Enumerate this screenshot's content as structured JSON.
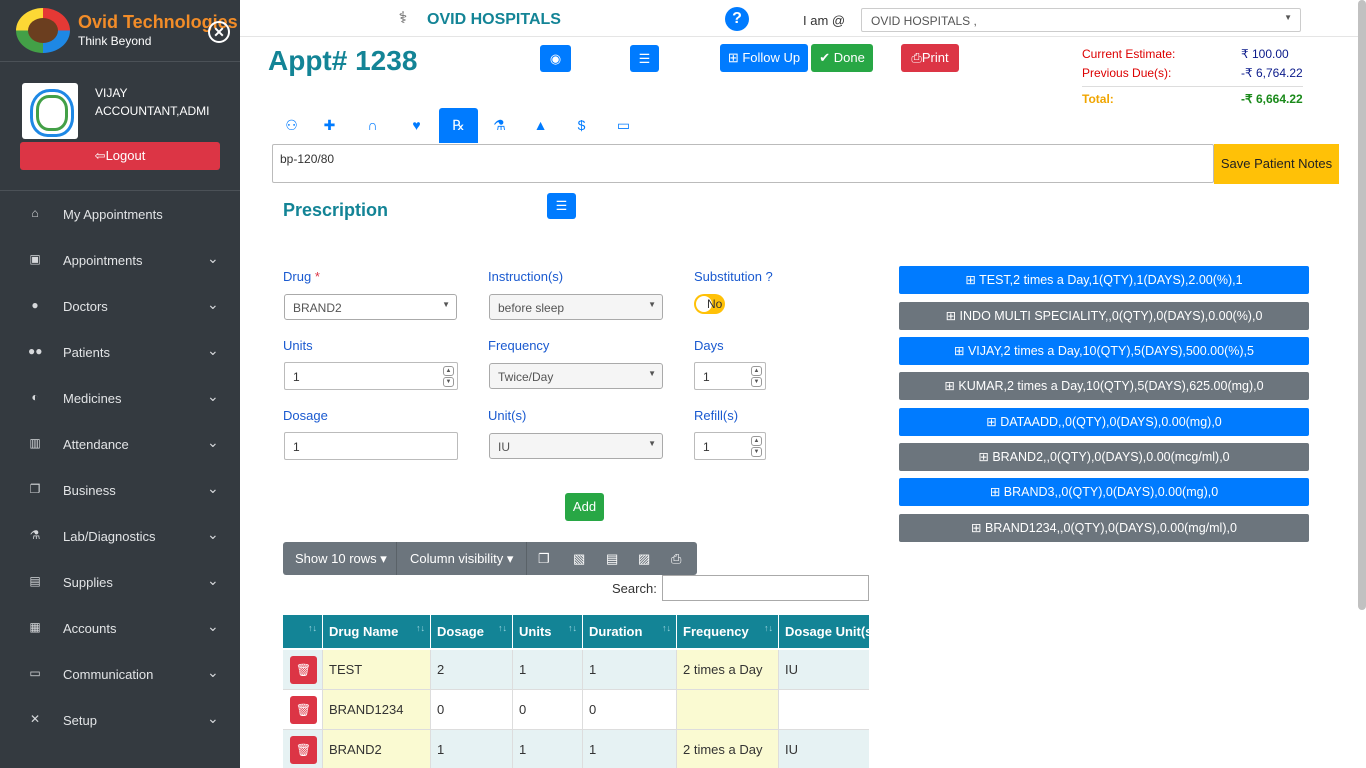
{
  "brand": {
    "name": "Ovid Technologies",
    "tagline": "Think Beyond"
  },
  "user": {
    "name": "VIJAY",
    "role": "ACCOUNTANT,ADMI",
    "logout_label": "Logout"
  },
  "nav": [
    {
      "label": "My Appointments",
      "icon": "home-icon",
      "chevron": false
    },
    {
      "label": "Appointments",
      "icon": "calendar-icon",
      "chevron": true
    },
    {
      "label": "Doctors",
      "icon": "doctor-icon",
      "chevron": true
    },
    {
      "label": "Patients",
      "icon": "users-icon",
      "chevron": true
    },
    {
      "label": "Medicines",
      "icon": "pills-icon",
      "chevron": true
    },
    {
      "label": "Attendance",
      "icon": "book-icon",
      "chevron": true
    },
    {
      "label": "Business",
      "icon": "copy-icon",
      "chevron": true
    },
    {
      "label": "Lab/Diagnostics",
      "icon": "flask-icon",
      "chevron": true
    },
    {
      "label": "Supplies",
      "icon": "warehouse-icon",
      "chevron": true
    },
    {
      "label": "Accounts",
      "icon": "file-invoice-icon",
      "chevron": true
    },
    {
      "label": "Communication",
      "icon": "id-card-icon",
      "chevron": true
    },
    {
      "label": "Setup",
      "icon": "tools-icon",
      "chevron": true
    }
  ],
  "topbar": {
    "hospital_name": "OVID HOSPITALS",
    "iam_label": "I am @",
    "hospital_select": "OVID HOSPITALS ,"
  },
  "appointment": {
    "title": "Appt# 1238"
  },
  "actions": {
    "follow_up": "Follow Up",
    "done": "Done",
    "print": "Print"
  },
  "estimate": {
    "current_label": "Current Estimate:",
    "current_value": "₹ 100.00",
    "previous_label": "Previous Due(s):",
    "previous_value": "-₹ 6,764.22",
    "total_label": "Total:",
    "total_value": "-₹ 6,664.22"
  },
  "tabs": [
    "user-icon",
    "notes-medical-icon",
    "stethoscope-icon",
    "heartbeat-icon",
    "prescription-icon",
    "flask-icon",
    "file-medical-icon",
    "dollar-icon",
    "money-bill-icon"
  ],
  "notes": {
    "value": "bp-120/80",
    "save_label": "Save Patient Notes"
  },
  "prescription": {
    "title": "Prescription",
    "drug_label": "Drug",
    "drug_required": "*",
    "drug_value": "BRAND2",
    "instruction_label": "Instruction(s)",
    "instruction_value": "before sleep",
    "substitution_label": "Substitution ?",
    "substitution_value": "No",
    "units_label": "Units",
    "units_value": "1",
    "frequency_label": "Frequency",
    "frequency_value": "Twice/Day",
    "days_label": "Days",
    "days_value": "1",
    "dosage_label": "Dosage",
    "dosage_value": "1",
    "unit_label": "Unit(s)",
    "unit_value": "IU",
    "refill_label": "Refill(s)",
    "refill_value": "1",
    "add_label": "Add"
  },
  "rx_list": [
    {
      "label": "TEST,2 times a Day,1(QTY),1(DAYS),2.00(%),1",
      "color": "#007bff"
    },
    {
      "label": "INDO MULTI SPECIALITY,,0(QTY),0(DAYS),0.00(%),0",
      "color": "#6c757d"
    },
    {
      "label": "VIJAY,2 times a Day,10(QTY),5(DAYS),500.00(%),5",
      "color": "#007bff"
    },
    {
      "label": "KUMAR,2 times a Day,10(QTY),5(DAYS),625.00(mg),0",
      "color": "#6c757d"
    },
    {
      "label": "DATAADD,,0(QTY),0(DAYS),0.00(mg),0",
      "color": "#007bff"
    },
    {
      "label": "BRAND2,,0(QTY),0(DAYS),0.00(mcg/ml),0",
      "color": "#6c757d"
    },
    {
      "label": "BRAND3,,0(QTY),0(DAYS),0.00(mg),0",
      "color": "#007bff"
    },
    {
      "label": "BRAND1234,,0(QTY),0(DAYS),0.00(mg/ml),0",
      "color": "#6c757d"
    }
  ],
  "table_tools": {
    "show_rows": "Show 10 rows",
    "column_visibility": "Column visibility",
    "search_label": "Search:"
  },
  "table": {
    "headers": [
      "",
      "Drug Name",
      "Dosage",
      "Units",
      "Duration",
      "Frequency",
      "Dosage Unit(s)"
    ],
    "rows": [
      [
        "",
        "TEST",
        "2",
        "1",
        "1",
        "2 times a Day",
        "IU"
      ],
      [
        "",
        "BRAND1234",
        "0",
        "0",
        "0",
        "",
        ""
      ],
      [
        "",
        "BRAND2",
        "1",
        "1",
        "1",
        "2 times a Day",
        "IU"
      ]
    ]
  }
}
